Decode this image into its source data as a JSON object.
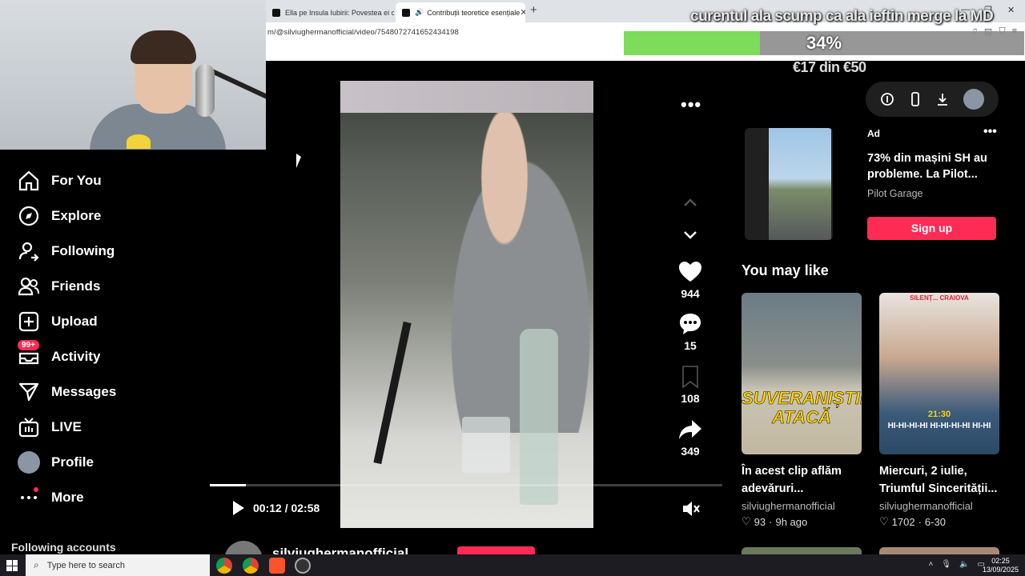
{
  "browser": {
    "tabs": [
      {
        "label": "Ella pe Insula Iubirii: Povestea ei capt"
      },
      {
        "label": "Contribuții teoretice esențiale"
      }
    ],
    "url": "m/@silviughermanofficial/video/7548072741652434198"
  },
  "stream_overlay": {
    "caption": "curentul ala scump ca ala ieftin merge la MD",
    "progress_percent": 34,
    "progress_label": "34%",
    "goal_label": "€17 din €50",
    "progress_color": "#7ddc5a"
  },
  "sidebar": {
    "items": [
      {
        "label": "For You",
        "icon": "home-icon"
      },
      {
        "label": "Explore",
        "icon": "compass-icon"
      },
      {
        "label": "Following",
        "icon": "user-follow-icon"
      },
      {
        "label": "Friends",
        "icon": "friends-icon"
      },
      {
        "label": "Upload",
        "icon": "plus-square-icon"
      },
      {
        "label": "Activity",
        "icon": "inbox-icon",
        "badge": "99+"
      },
      {
        "label": "Messages",
        "icon": "send-icon"
      },
      {
        "label": "LIVE",
        "icon": "tv-icon"
      },
      {
        "label": "Profile",
        "icon": "avatar"
      },
      {
        "label": "More",
        "icon": "more-icon"
      }
    ],
    "following_accounts_label": "Following accounts"
  },
  "player": {
    "time": "00:12 / 02:58",
    "progress_fraction": 0.07,
    "author": "silviughermanofficial"
  },
  "actions": {
    "likes": "944",
    "comments": "15",
    "saves": "108",
    "shares": "349"
  },
  "ad": {
    "tag": "Ad",
    "title": "73% din mașini SH au probleme. La Pilot...",
    "brand": "Pilot Garage",
    "cta": "Sign up"
  },
  "you_may_like": {
    "heading": "You may like",
    "items": [
      {
        "caption": "În acest clip aflăm adevăruri...",
        "author": "silviughermanofficial",
        "likes": "93",
        "date": "9h ago",
        "thumb_text": "SUVERANIȘTII ATACĂ"
      },
      {
        "caption": "Miercuri, 2 iulie, Triumful Sincerității...",
        "author": "silviughermanofficial",
        "likes": "1702",
        "date": "6-30",
        "thumb_top": "SILENȚ... CRAIOVA",
        "thumb_time": "21:30",
        "thumb_hi": "HI-HI-HI-HI HI-HI-HI-HI HI-HI"
      }
    ]
  },
  "taskbar": {
    "search_placeholder": "Type here to search",
    "time": "02:25",
    "date": "13/09/2025"
  }
}
